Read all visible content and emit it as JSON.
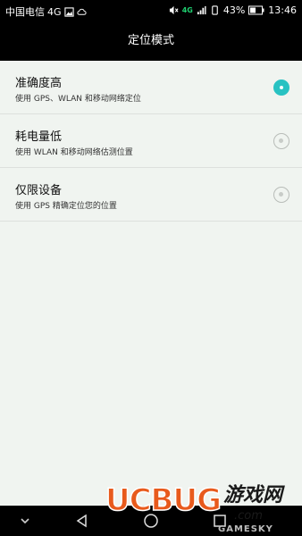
{
  "status_bar": {
    "carrier": "中国电信",
    "network": "4G",
    "signal_network_tag": "4G",
    "battery": "43%",
    "time": "13:46"
  },
  "header": {
    "title": "定位模式"
  },
  "options": [
    {
      "title": "准确度高",
      "subtitle": "使用 GPS、WLAN 和移动网络定位",
      "selected": true
    },
    {
      "title": "耗电量低",
      "subtitle": "使用 WLAN 和移动网络估测位置",
      "selected": false
    },
    {
      "title": "仅限设备",
      "subtitle": "使用 GPS 精确定位您的位置",
      "selected": false
    }
  ],
  "colors": {
    "accent": "#28c2c2",
    "background": "#f0f4f0",
    "bar": "#000000"
  },
  "watermark": {
    "logo_text": "UCBUG",
    "cn_text": "游戏网",
    "domain": ".com",
    "site": "GAMESKY"
  },
  "icons": {
    "status_left": [
      "image-icon",
      "cloud-icon"
    ],
    "status_right": [
      "mute-icon",
      "signal-icon",
      "battery-icon"
    ],
    "nav": [
      "chevron-down-icon",
      "back-icon",
      "home-icon",
      "recents-icon"
    ]
  }
}
